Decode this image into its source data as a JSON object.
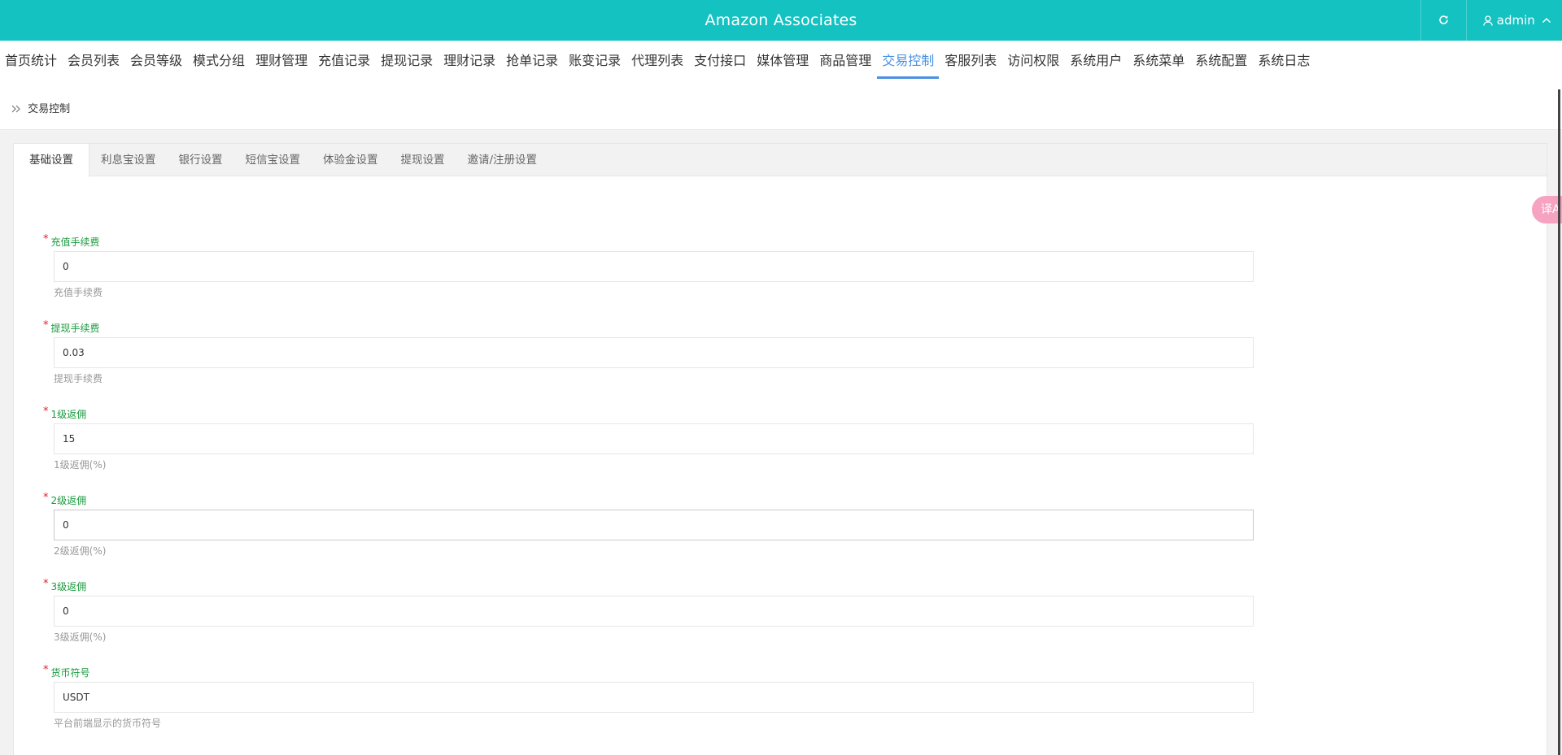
{
  "header": {
    "title": "Amazon Associates",
    "user": "admin",
    "refresh_icon": "refresh-icon",
    "user_icon": "user-icon",
    "chevron_icon": "chevron-up-icon",
    "bg_color": "#14c2c2"
  },
  "nav": {
    "items": [
      "首页统计",
      "会员列表",
      "会员等级",
      "模式分组",
      "理财管理",
      "充值记录",
      "提现记录",
      "理财记录",
      "抢单记录",
      "账变记录",
      "代理列表",
      "支付接口",
      "媒体管理",
      "商品管理",
      "交易控制",
      "客服列表",
      "访问权限",
      "系统用户",
      "系统菜单",
      "系统配置",
      "系统日志"
    ],
    "active": "交易控制",
    "active_color": "#4a90e2"
  },
  "breadcrumb": {
    "icon": "double-chevron-right-icon",
    "label": "交易控制"
  },
  "tabs": {
    "items": [
      "基础设置",
      "利息宝设置",
      "银行设置",
      "短信宝设置",
      "体验金设置",
      "提现设置",
      "邀请/注册设置"
    ],
    "active": "基础设置"
  },
  "form": {
    "required_mark": "*",
    "fields": [
      {
        "label": "充值手续费",
        "value": "0",
        "help": "充值手续费"
      },
      {
        "label": "提现手续费",
        "value": "0.03",
        "help": "提现手续费"
      },
      {
        "label": "1级返佣",
        "value": "15",
        "help": "1级返佣(%)"
      },
      {
        "label": "2级返佣",
        "value": "0",
        "help": "2级返佣(%)"
      },
      {
        "label": "3级返佣",
        "value": "0",
        "help": "3级返佣(%)"
      },
      {
        "label": "货币符号",
        "value": "USDT",
        "help": "平台前端显示的货币符号"
      }
    ]
  },
  "floating_button": {
    "icon": "translate-icon",
    "text": "译A",
    "color": "#f5a3c0"
  }
}
